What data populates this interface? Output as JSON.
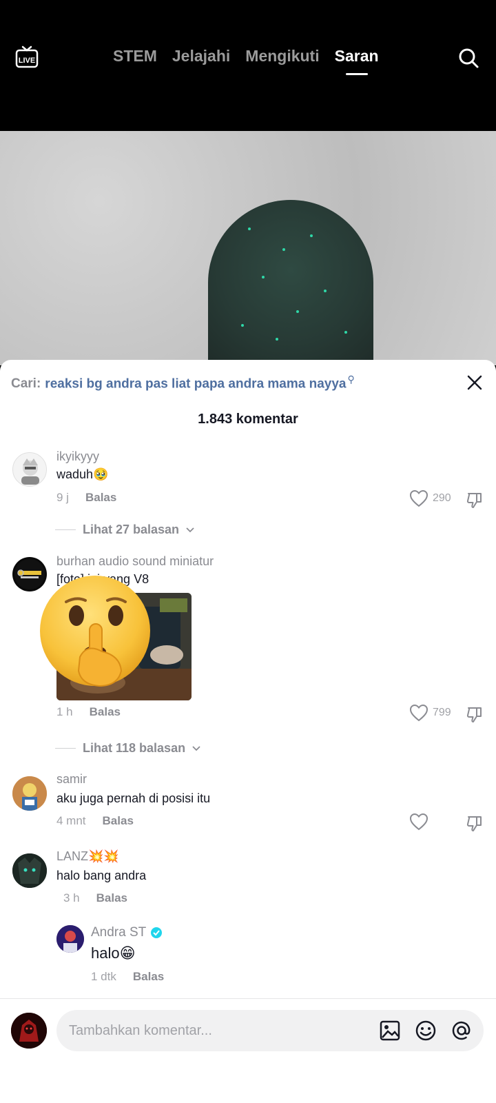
{
  "nav": {
    "tabs": [
      {
        "label": "STEM",
        "active": false
      },
      {
        "label": "Jelajahi",
        "active": false
      },
      {
        "label": "Mengikuti",
        "active": false
      },
      {
        "label": "Saran",
        "active": true
      }
    ]
  },
  "sheet": {
    "search_label": "Cari:",
    "search_query": "reaksi bg andra pas liat papa andra mama nayya",
    "comment_count": "1.843 komentar"
  },
  "comments": [
    {
      "username": "ikyikyyy",
      "text": "waduh🥹",
      "time": "9 j",
      "reply": "Balas",
      "likes": "290",
      "view_replies": "Lihat 27 balasan"
    },
    {
      "username": "burhan audio sound miniatur",
      "text": "[foto] ini yang V8",
      "time": "1 h",
      "reply": "Balas",
      "likes": "799",
      "view_replies": "Lihat 118 balasan"
    },
    {
      "username": "samir",
      "text": "aku juga pernah di posisi itu",
      "time": "4 mnt",
      "reply": "Balas",
      "likes": ""
    },
    {
      "username": "LANZ💥💥",
      "text": "halo bang andra",
      "time": "3 h",
      "reply": "Balas"
    },
    {
      "username": "Andra ST",
      "text": "halo😁",
      "time": "1 dtk",
      "reply": "Balas"
    }
  ],
  "input": {
    "placeholder": "Tambahkan komentar..."
  },
  "colors": {
    "accent_link": "#4f6fa0",
    "verified": "#20d5ec"
  }
}
